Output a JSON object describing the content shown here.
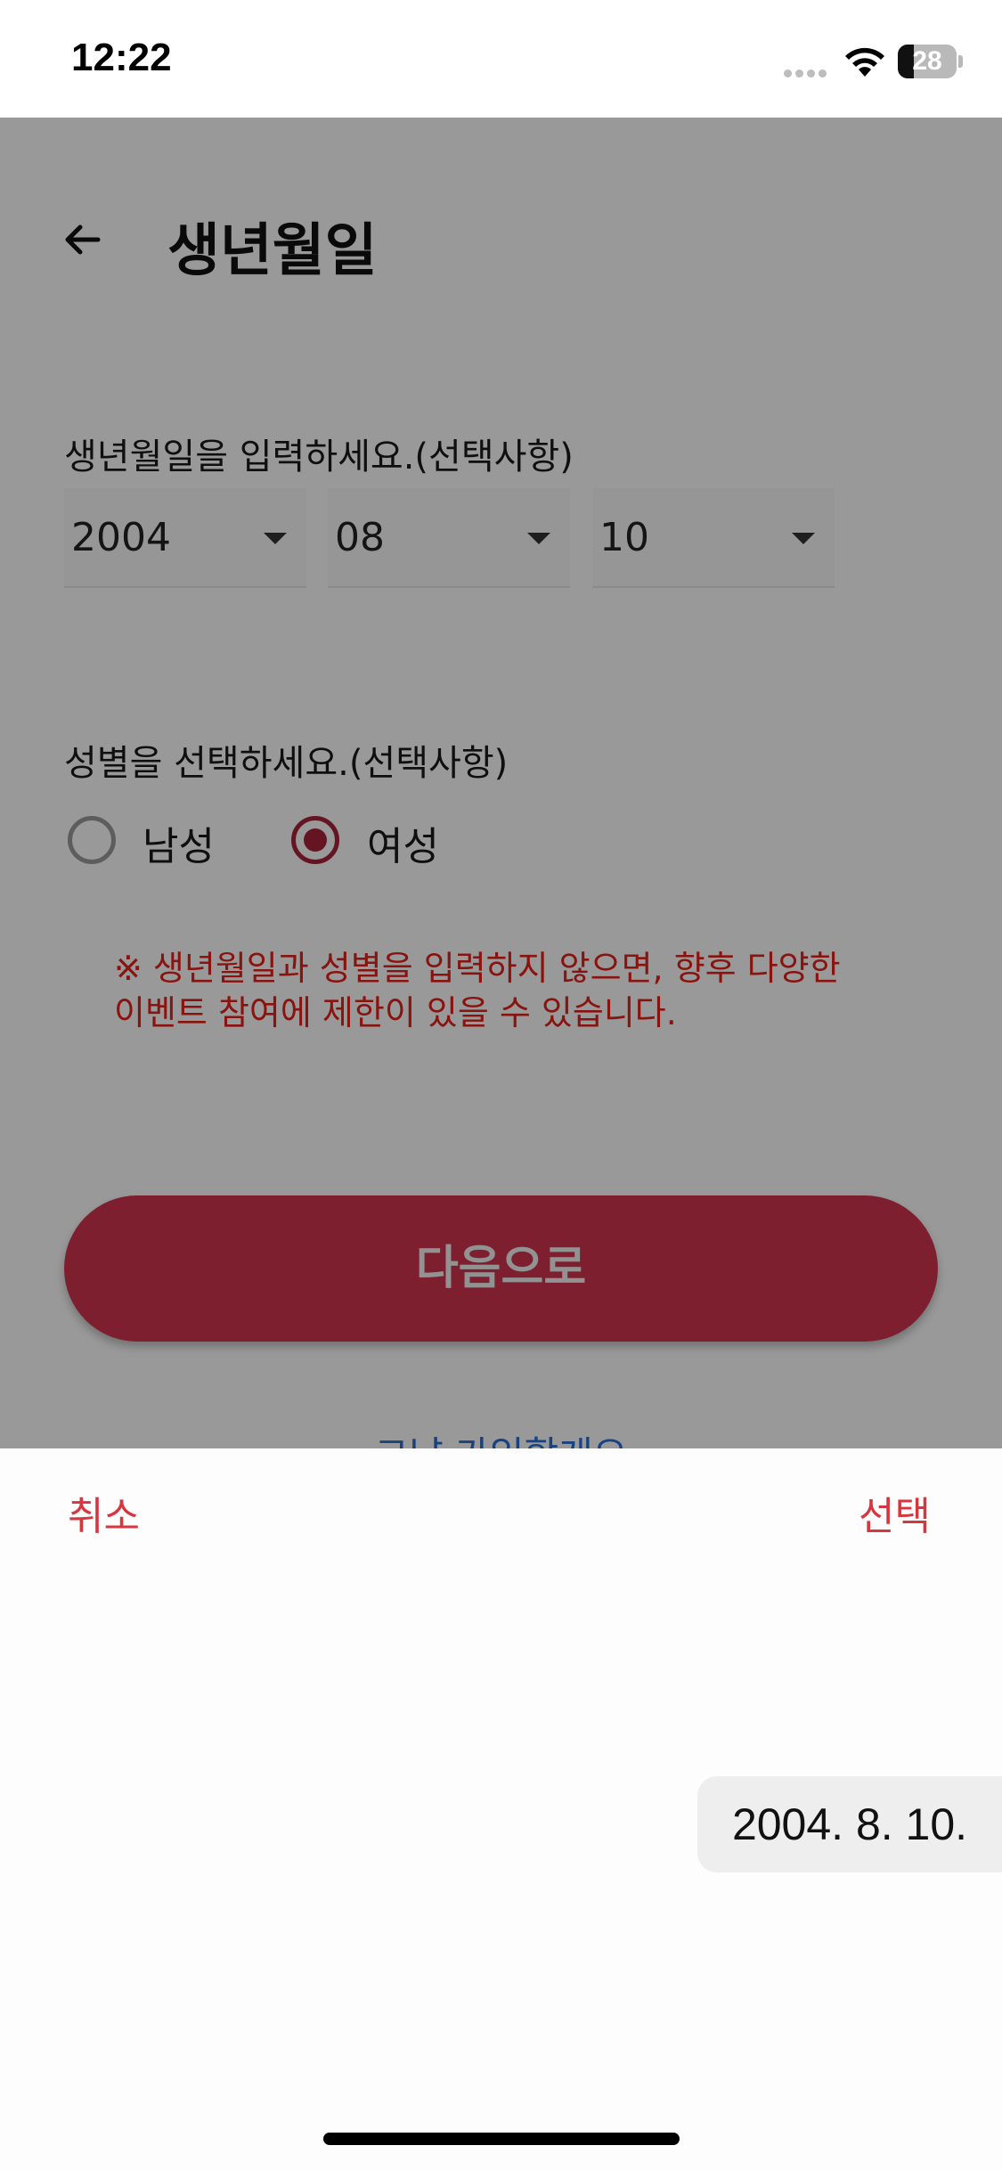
{
  "status_bar": {
    "time": "12:22",
    "battery_level": "28",
    "battery_fraction": 0.28
  },
  "header": {
    "back_icon": "arrow-left-icon",
    "title": "생년월일"
  },
  "birthdate": {
    "label": "생년월일을 입력하세요.(선택사항)",
    "year": "2004",
    "month": "08",
    "day": "10"
  },
  "gender": {
    "label": "성별을 선택하세요.(선택사항)",
    "options": [
      {
        "label": "남성",
        "selected": false
      },
      {
        "label": "여성",
        "selected": true
      }
    ]
  },
  "notice": {
    "line1": "※ 생년월일과 성별을 입력하지 않으면, 향후 다양한",
    "line2": "이벤트 참여에 제한이 있을 수 있습니다."
  },
  "next_button": {
    "label": "다음으로"
  },
  "later_link": {
    "label": "그냥 가입할게요"
  },
  "date_sheet": {
    "cancel_label": "취소",
    "select_label": "선택",
    "selected_date": "2004. 8. 10."
  },
  "colors": {
    "accent": "#d0344d",
    "radio_selected": "#a8233a",
    "notice_text": "#e32119",
    "sheet_action": "#d6373f",
    "link": "#2a6fd6"
  }
}
